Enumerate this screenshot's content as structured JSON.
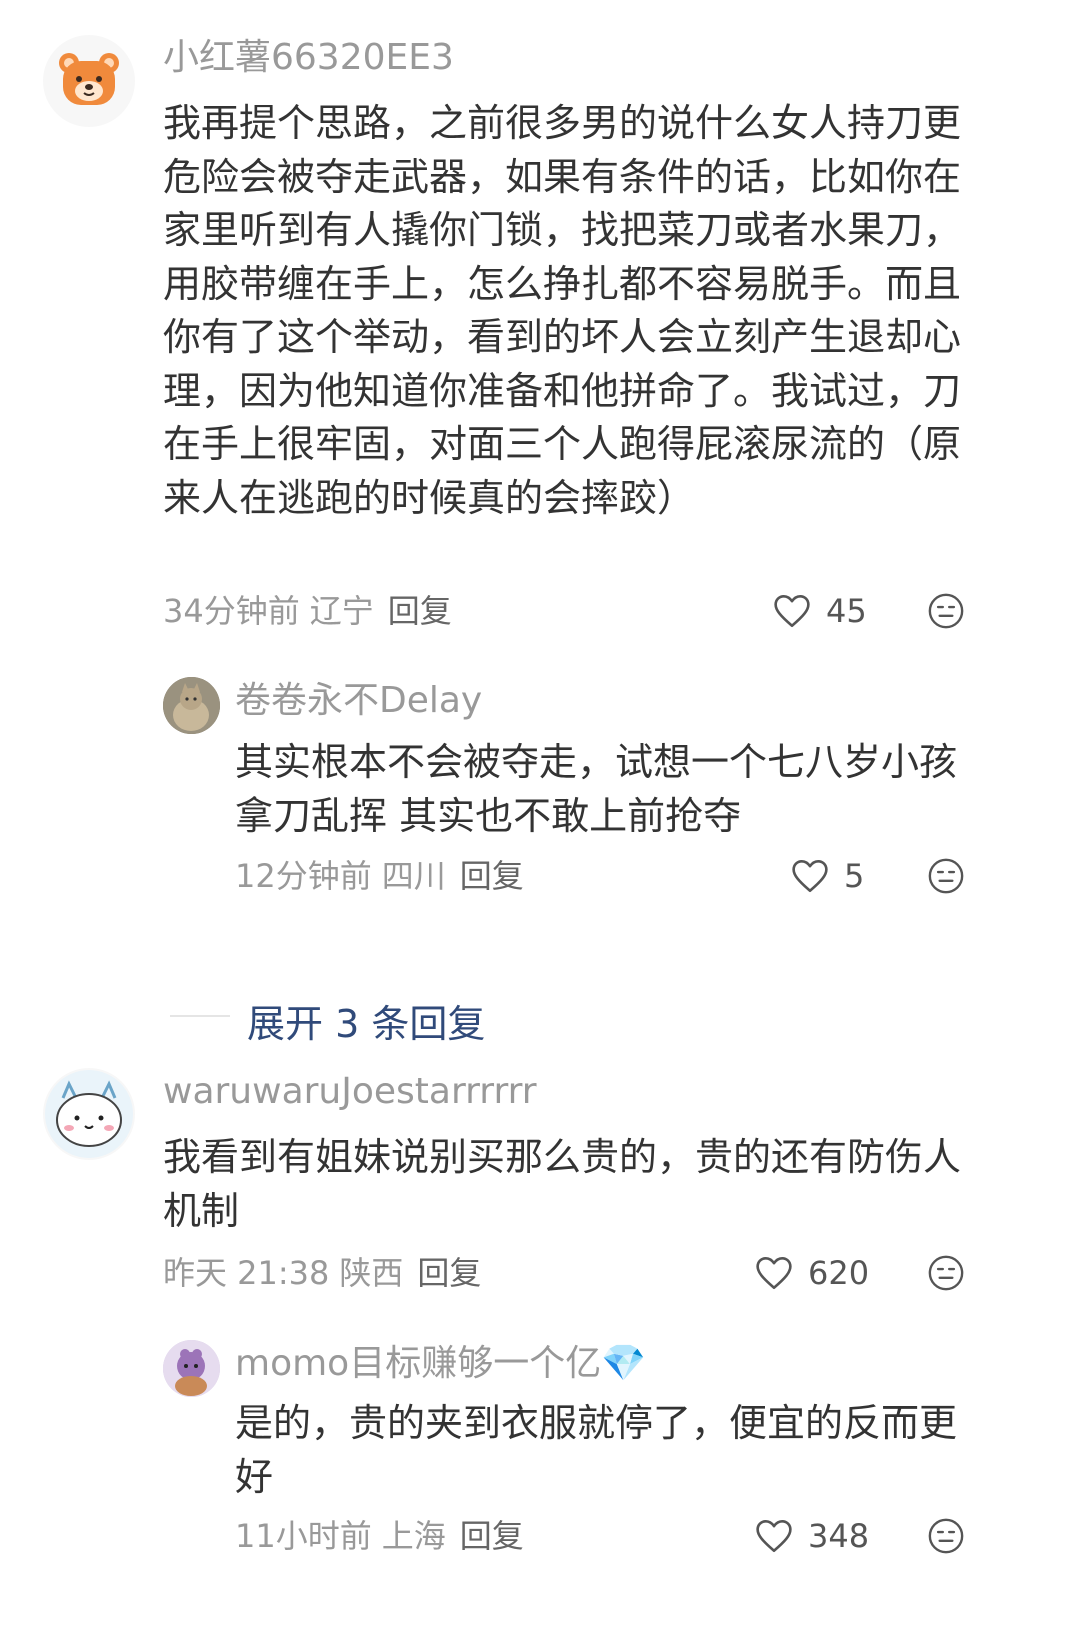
{
  "comments": [
    {
      "username": "小红薯66320EE3",
      "text": "我再提个思路，之前很多男的说什么女人持刀更危险会被夺走武器，如果有条件的话，比如你在家里听到有人撬你门锁，找把菜刀或者水果刀，用胶带缠在手上，怎么挣扎都不容易脱手。而且你有了这个举动，看到的坏人会立刻产生退却心理，因为他知道你准备和他拼命了。我试过，刀在手上很牢固，对面三个人跑得屁滚尿流的（原来人在逃跑的时候真的会摔跤）",
      "time": "34分钟前",
      "location": "辽宁",
      "reply_label": "回复",
      "likes": "45",
      "replies": [
        {
          "username": "卷卷永不Delay",
          "text": "其实根本不会被夺走，试想一个七八岁小孩拿刀乱挥 其实也不敢上前抢夺",
          "time": "12分钟前",
          "location": "四川",
          "reply_label": "回复",
          "likes": "5"
        }
      ],
      "expand_label": "展开 3 条回复"
    },
    {
      "username": "waruwaruJoestarrrrrr",
      "text": "我看到有姐妹说别买那么贵的，贵的还有防伤人机制",
      "time": "昨天 21:38",
      "location": "陕西",
      "reply_label": "回复",
      "likes": "620",
      "replies": [
        {
          "username": "momo目标赚够一个亿💎",
          "text": "是的，贵的夹到衣服就停了，便宜的反而更好",
          "time": "11小时前",
          "location": "上海",
          "reply_label": "回复",
          "likes": "348"
        }
      ]
    }
  ],
  "icons": {
    "like": "heart-outline-icon",
    "dislike": "neutral-face-icon"
  },
  "colors": {
    "text": "#333333",
    "secondary": "#999999",
    "link": "#304a7a",
    "avatar_bear": "#f08a3c"
  }
}
